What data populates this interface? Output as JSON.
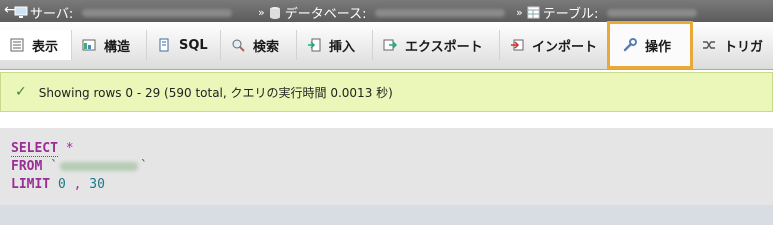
{
  "breadcrumb": {
    "server_label": "サーバ:",
    "database_label": "データベース:",
    "table_label": "テーブル:"
  },
  "tabs": [
    {
      "label": "表示",
      "icon": "browse-icon"
    },
    {
      "label": "構造",
      "icon": "structure-icon"
    },
    {
      "label": "SQL",
      "icon": "sql-icon"
    },
    {
      "label": "検索",
      "icon": "search-icon"
    },
    {
      "label": "挿入",
      "icon": "insert-icon"
    },
    {
      "label": "エクスポート",
      "icon": "export-icon"
    },
    {
      "label": "インポート",
      "icon": "import-icon"
    },
    {
      "label": "操作",
      "icon": "wrench-icon"
    },
    {
      "label": "トリガ",
      "icon": "trigger-icon"
    }
  ],
  "message": {
    "text": "Showing rows 0 - 29 (590 total, クエリの実行時間 0.0013 秒)"
  },
  "sql": {
    "select": "SELECT",
    "star": "*",
    "from": "FROM",
    "limit": "LIMIT",
    "offset": "0",
    "comma": ",",
    "count": "30"
  }
}
